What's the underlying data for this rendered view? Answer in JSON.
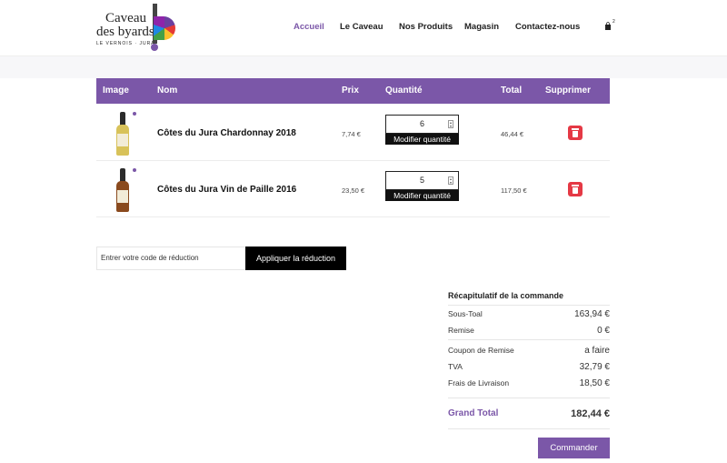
{
  "brand": {
    "line1": "Caveau",
    "line2": "des byards",
    "tagline": "LE VERNOIS · JURA"
  },
  "nav": {
    "items": [
      "Accueil",
      "Le Caveau",
      "Nos Produits",
      "Magasin",
      "Contactez-nous"
    ],
    "active": "Accueil"
  },
  "cart": {
    "count": "2"
  },
  "table": {
    "headers": [
      "Image",
      "Nom",
      "Prix",
      "Quantité",
      "Total",
      "Supprimer"
    ],
    "rows": [
      {
        "name": "Côtes du Jura Chardonnay 2018",
        "price": "7,74 €",
        "quantity": "6",
        "modify_label": "Modifier quantité",
        "total": "46,44 €",
        "bottle_color": "#d8c25a"
      },
      {
        "name": "Côtes du Jura Vin de Paille 2016",
        "price": "23,50 €",
        "quantity": "5",
        "modify_label": "Modifier quantité",
        "total": "117,50 €",
        "bottle_color": "#8a4a1e"
      }
    ]
  },
  "coupon": {
    "placeholder": "Entrer votre code de réduction",
    "button": "Appliquer la réduction"
  },
  "summary": {
    "title": "Récapitulatif de la commande",
    "subtotal_label": "Sous-Toal",
    "subtotal": "163,94 €",
    "discount_label": "Remise",
    "discount": "0 €",
    "coupon_label": "Coupon de Remise",
    "coupon": "a faire",
    "tax_label": "TVA",
    "tax": "32,79 €",
    "shipping_label": "Frais de Livraison",
    "shipping": "18,50 €",
    "grand_total_label": "Grand Total",
    "grand_total": "182,44 €",
    "order_button": "Commander"
  },
  "colors": {
    "accent": "#7b57a8",
    "delete": "#e53945",
    "dark": "#000000"
  }
}
